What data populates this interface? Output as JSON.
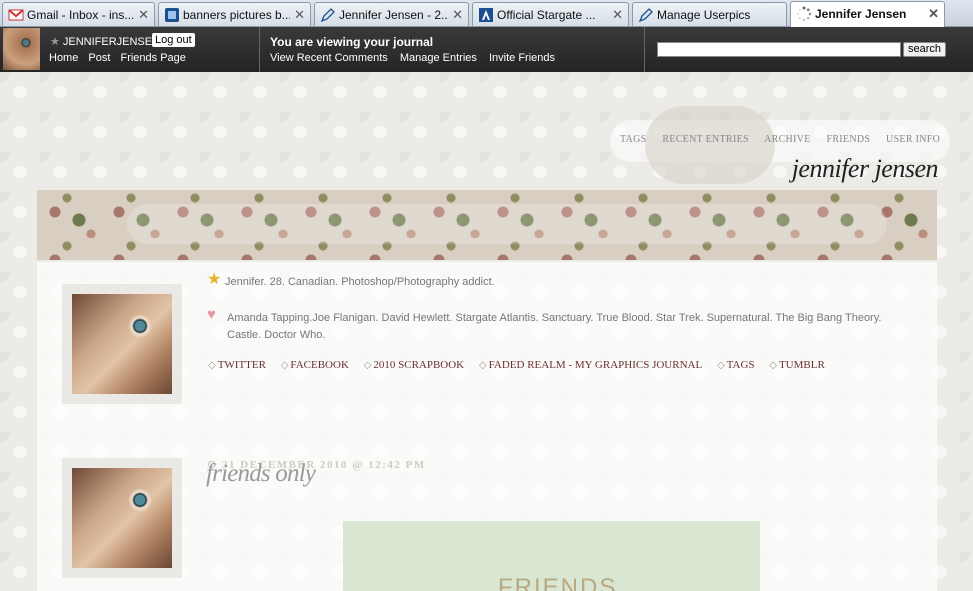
{
  "browser": {
    "tabs": [
      {
        "label": "Gmail - Inbox - ins...",
        "icon": "gmail-icon",
        "active": false
      },
      {
        "label": "banners pictures b...",
        "icon": "photobucket-icon",
        "active": false
      },
      {
        "label": "Jennifer Jensen - 2...",
        "icon": "livejournal-pencil-icon",
        "active": false
      },
      {
        "label": "Official Stargate ...",
        "icon": "stargate-icon",
        "active": false
      },
      {
        "label": "Manage Userpics",
        "icon": "livejournal-pencil-icon",
        "active": false
      },
      {
        "label": "Jennifer Jensen",
        "icon": "loading-spinner-icon",
        "active": true
      }
    ]
  },
  "sitebar": {
    "username": "JENNIFERJENSEN",
    "logout": "Log out",
    "nav": [
      "Home",
      "Post",
      "Friends Page"
    ],
    "viewing": "You are viewing your journal",
    "links": [
      "View Recent Comments",
      "Manage Entries",
      "Invite Friends"
    ],
    "search_value": "",
    "search_button": "search"
  },
  "journal": {
    "nav": [
      "TAGS",
      "RECENT ENTRIES",
      "ARCHIVE",
      "FRIENDS",
      "USER INFO"
    ],
    "title": "jennifer jensen",
    "profile_line1": "Jennifer. 28. Canadian. Photoshop/Photography addict.",
    "profile_line2": "Amanda Tapping.Joe Flanigan. David Hewlett. Stargate Atlantis. Sanctuary. True Blood. Star Trek. Supernatural. The Big Bang Theory. Castle. Doctor Who.",
    "links": [
      "TWITTER",
      "FACEBOOK",
      "2010 SCRAPBOOK",
      "FADED REALM - MY GRAPHICS JOURNAL",
      "TAGS",
      "TUMBLR"
    ],
    "entry": {
      "date": "31 DECEMBER 2010 @ 12:42 PM",
      "subject": "friends only",
      "image_text": "FRIENDS"
    }
  },
  "colors": {
    "sitebar_bg": "#2e2e2e",
    "link_color": "#6a3030",
    "page_bg": "#ecebe7"
  }
}
